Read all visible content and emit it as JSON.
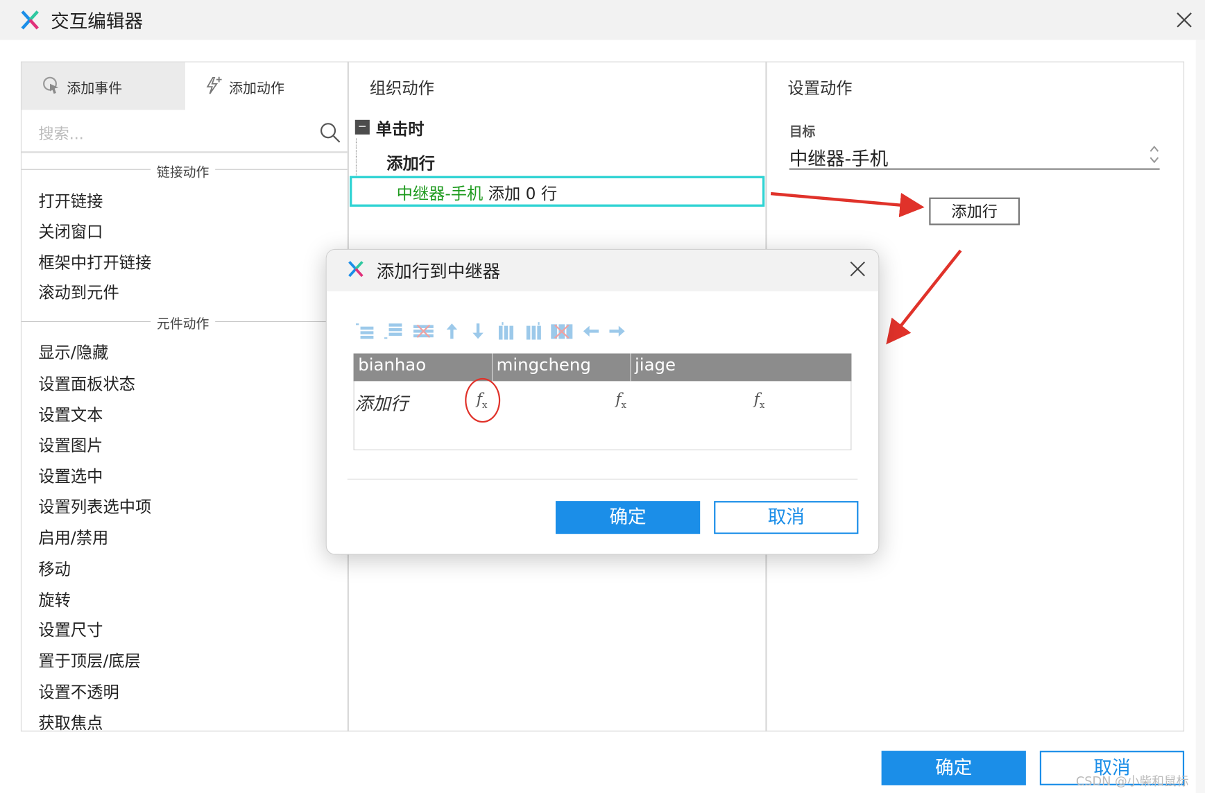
{
  "window": {
    "title": "交互编辑器"
  },
  "left_panel": {
    "tab_add_event": "添加事件",
    "tab_add_action": "添加动作",
    "search_placeholder": "搜索...",
    "section_link": "链接动作",
    "link_actions": [
      "打开链接",
      "关闭窗口",
      "框架中打开链接",
      "滚动到元件"
    ],
    "section_widget": "元件动作",
    "widget_actions": [
      "显示/隐藏",
      "设置面板状态",
      "设置文本",
      "设置图片",
      "设置选中",
      "设置列表选中项",
      "启用/禁用",
      "移动",
      "旋转",
      "设置尺寸",
      "置于顶层/底层",
      "设置不透明",
      "获取焦点"
    ]
  },
  "middle_panel": {
    "title": "组织动作",
    "event": "单击时",
    "case": "添加行",
    "action_target": "中继器-手机",
    "action_rest": "添加 0 行"
  },
  "right_panel": {
    "title": "设置动作",
    "target_label": "目标",
    "target_value": "中继器-手机",
    "add_row_button": "添加行"
  },
  "dialog": {
    "title": "添加行到中继器",
    "columns": [
      "bianhao",
      "mingcheng",
      "jiage"
    ],
    "row_label": "添加行",
    "fx": "f",
    "fx_sub": "x",
    "ok": "确定",
    "cancel": "取消"
  },
  "footer": {
    "ok": "确定",
    "cancel": "取消"
  },
  "watermark": "CSDN @小柴和鼠标",
  "colors": {
    "primary": "#1b8ee8",
    "selection_border": "#2fd3d3",
    "action_target_green": "#1d9a1d",
    "annotation_red": "#e0322a"
  }
}
